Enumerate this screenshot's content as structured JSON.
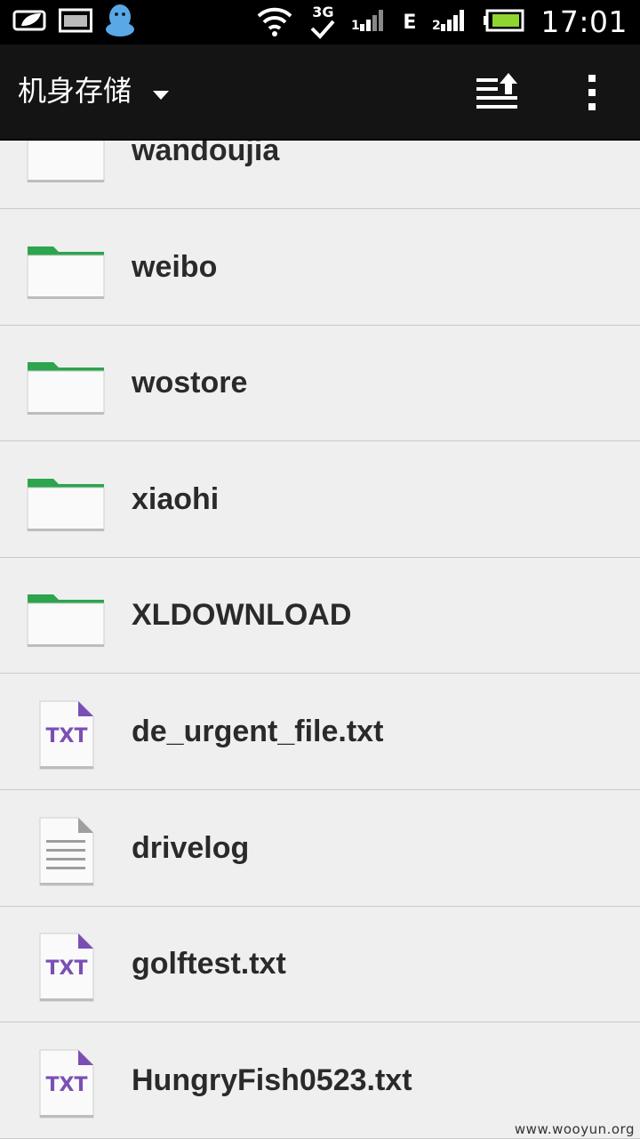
{
  "status_bar": {
    "time": "17:01",
    "network_3g": "3G",
    "network_e": "E",
    "icons": [
      "battery-saver-icon",
      "gallery-icon",
      "qq-icon",
      "wifi-icon",
      "3g-sync-icon",
      "signal-1-icon",
      "signal-2-icon",
      "battery-icon"
    ]
  },
  "action_bar": {
    "title": "机身存储",
    "upload_icon": "sort-upload-icon",
    "menu_icon": "overflow-menu-icon"
  },
  "files": [
    {
      "name": "wandoujia",
      "type": "folder"
    },
    {
      "name": "weibo",
      "type": "folder"
    },
    {
      "name": "wostore",
      "type": "folder"
    },
    {
      "name": "xiaohi",
      "type": "folder"
    },
    {
      "name": "XLDOWNLOAD",
      "type": "folder"
    },
    {
      "name": "de_urgent_file.txt",
      "type": "txt"
    },
    {
      "name": "drivelog",
      "type": "doc"
    },
    {
      "name": "golftest.txt",
      "type": "txt"
    },
    {
      "name": "HungryFish0523.txt",
      "type": "txt"
    }
  ],
  "icon_labels": {
    "txt": "TXT"
  },
  "colors": {
    "folder_tab": "#2da44e",
    "txt_accent": "#7a4fb5",
    "action_bar": "#141414"
  },
  "watermark": "www.wooyun.org"
}
